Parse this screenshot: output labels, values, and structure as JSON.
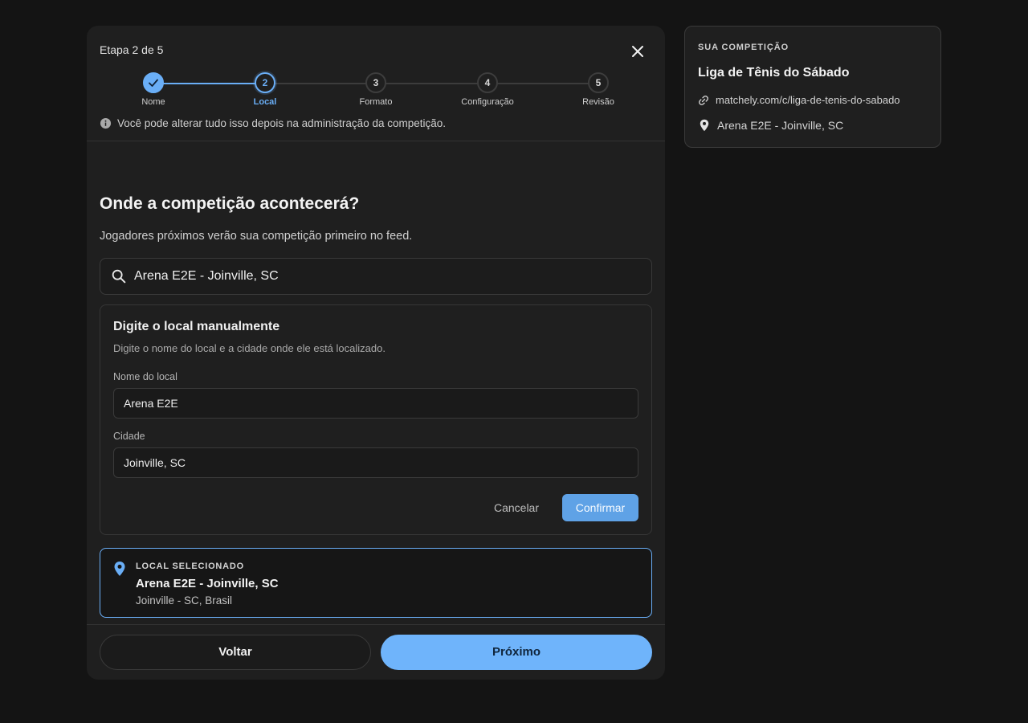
{
  "header": {
    "step_count": "Etapa 2 de 5",
    "hint": "Você pode alterar tudo isso depois na administração da competição."
  },
  "stepper": {
    "steps": [
      {
        "number": "1",
        "label": "Nome",
        "state": "done"
      },
      {
        "number": "2",
        "label": "Local",
        "state": "active"
      },
      {
        "number": "3",
        "label": "Formato",
        "state": "pending"
      },
      {
        "number": "4",
        "label": "Configuração",
        "state": "pending"
      },
      {
        "number": "5",
        "label": "Revisão",
        "state": "pending"
      }
    ]
  },
  "main": {
    "title": "Onde a competição acontecerá?",
    "subtitle": "Jogadores próximos verão sua competição primeiro no feed.",
    "search_value": "Arena E2E - Joinville, SC"
  },
  "manual": {
    "title": "Digite o local manualmente",
    "description": "Digite o nome do local e a cidade onde ele está localizado.",
    "venue_label": "Nome do local",
    "venue_value": "Arena E2E",
    "city_label": "Cidade",
    "city_value": "Joinville, SC",
    "cancel_label": "Cancelar",
    "confirm_label": "Confirmar"
  },
  "selected": {
    "kicker": "LOCAL SELECIONADO",
    "name": "Arena E2E - Joinville, SC",
    "sub": "Joinville - SC, Brasil"
  },
  "footer": {
    "back_label": "Voltar",
    "next_label": "Próximo"
  },
  "side": {
    "kicker": "SUA COMPETIÇÃO",
    "title": "Liga de Tênis do Sábado",
    "url": "matchely.com/c/liga-de-tenis-do-sabado",
    "location": "Arena E2E - Joinville, SC"
  },
  "colors": {
    "accent": "#6aaef6",
    "background": "#141414",
    "panel": "#1f1f1f"
  }
}
